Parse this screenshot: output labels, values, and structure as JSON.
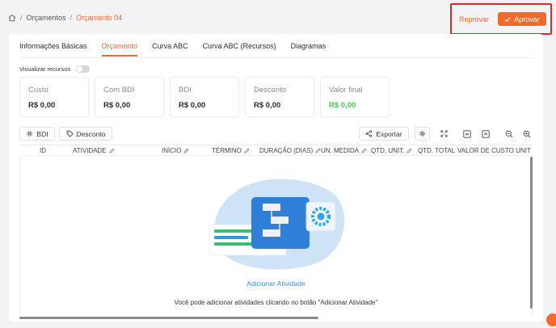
{
  "breadcrumb": {
    "item1": "Orçamentos",
    "current": "Orçamento 04",
    "separator": "/"
  },
  "actions": {
    "reprovar": "Reprovar",
    "aprovar": "Aprovar"
  },
  "tabs": [
    {
      "label": "Informações Básicas"
    },
    {
      "label": "Orçamento"
    },
    {
      "label": "Curva ABC"
    },
    {
      "label": "Curva ABC (Recursos)"
    },
    {
      "label": "Diagramas"
    }
  ],
  "visualizar": {
    "label": "Visualizar recursos"
  },
  "kpis": [
    {
      "label": "Custo",
      "value": "R$ 0,00"
    },
    {
      "label": "Com BDI",
      "value": "R$ 0,00"
    },
    {
      "label": "BDI",
      "value": "R$ 0,00"
    },
    {
      "label": "Desconto",
      "value": "R$ 0,00"
    },
    {
      "label": "Valor final",
      "value": "R$ 0,00"
    }
  ],
  "toolbar": {
    "bdi": "BDI",
    "desconto": "Desconto",
    "exportar": "Exportar"
  },
  "columns": [
    {
      "label": "ID"
    },
    {
      "label": "ATIVIDADE"
    },
    {
      "label": "INÍCIO"
    },
    {
      "label": "TÉRMINO"
    },
    {
      "label": "DURAÇÃO (DIAS)"
    },
    {
      "label": "UN. MEDIDA"
    },
    {
      "label": "QTD. UNIT."
    },
    {
      "label": "QTD. TOTAL"
    },
    {
      "label": "VALOR DE CUSTO UNIT"
    }
  ],
  "empty": {
    "add_link": "Adicionar Atividade",
    "message": "Você pode adicionar atividades clicando no botão \"Adicionar Atividade\""
  },
  "colors": {
    "accent": "#f06a2a",
    "success": "#4cc24c",
    "link": "#3b8fd8",
    "highlight": "#e5262b"
  }
}
